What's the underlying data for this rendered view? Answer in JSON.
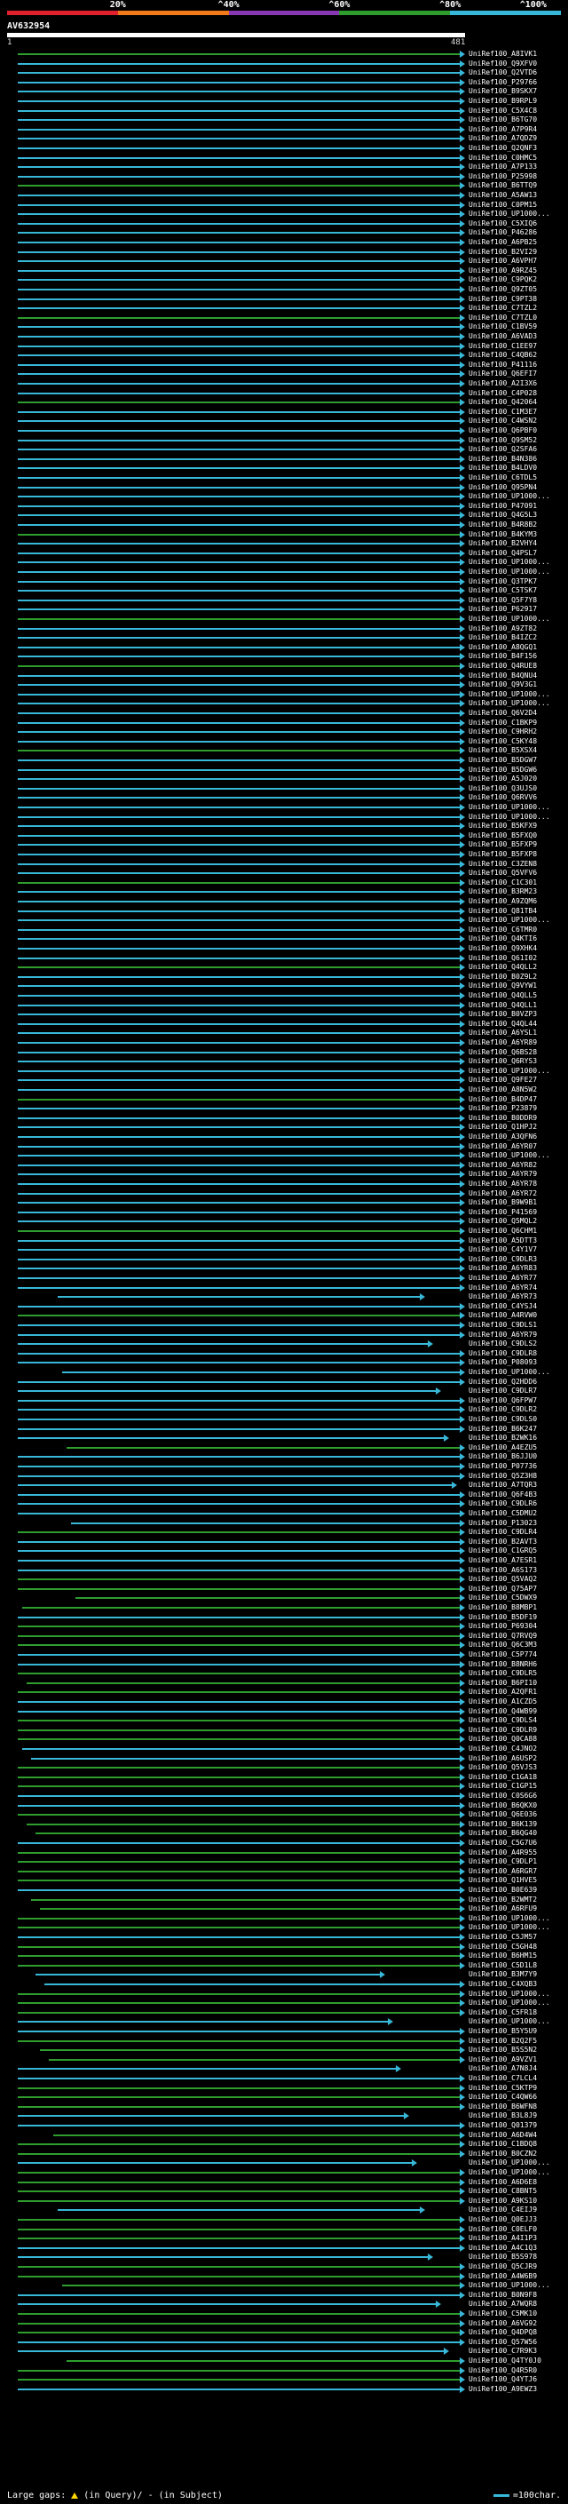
{
  "scale": {
    "labels": [
      "20%",
      "^40%",
      "^60%",
      "^80%",
      "^100%"
    ],
    "colors": [
      "#e0202c",
      "#f07a1a",
      "#8a37b4",
      "#2e9d2e",
      "#38b8d8"
    ]
  },
  "query": {
    "name": "AV632954",
    "start": "1",
    "end": "481"
  },
  "legend": {
    "large_gaps": "Large gaps:",
    "in_query": "(in Query)/",
    "in_subject": "(in Subject)",
    "scale_note": "=100char."
  },
  "hits": [
    "UniRef100_A8IVK1",
    "UniRef100_Q9XFV0",
    "UniRef100_Q2VTD6",
    "UniRef100_P29766",
    "UniRef100_B9SKX7",
    "UniRef100_B9RPL9",
    "UniRef100_C5X4C8",
    "UniRef100_B6TG70",
    "UniRef100_A7P9R4",
    "UniRef100_A7QDZ9",
    "UniRef100_Q2QNF3",
    "UniRef100_C0HMC5",
    "UniRef100_A7P133",
    "UniRef100_P25998",
    "UniRef100_B6TTQ9",
    "UniRef100_A5AW13",
    "UniRef100_C0PM15",
    "UniRef100_UP1000...",
    "UniRef100_C5XIQ6",
    "UniRef100_P46286",
    "UniRef100_A6PB25",
    "UniRef100_B2VI29",
    "UniRef100_A6VPH7",
    "UniRef100_A9RZ45",
    "UniRef100_C9PQK2",
    "UniRef100_Q9ZT05",
    "UniRef100_C9PT38",
    "UniRef100_C7TZL2",
    "UniRef100_C7TZL0",
    "UniRef100_C1BV59",
    "UniRef100_A6VAD3",
    "UniRef100_C1EE97",
    "UniRef100_C4QB62",
    "UniRef100_P41116",
    "UniRef100_Q6EFI7",
    "UniRef100_A2I3X6",
    "UniRef100_C4P028",
    "UniRef100_Q42064",
    "UniRef100_C1M3E7",
    "UniRef100_C4WSN2",
    "UniRef100_Q6PBF0",
    "UniRef100_Q9SM52",
    "UniRef100_Q2SFA6",
    "UniRef100_B4N386",
    "UniRef100_B4LDV0",
    "UniRef100_C6TDL5",
    "UniRef100_Q95PN4",
    "UniRef100_UP1000...",
    "UniRef100_P47091",
    "UniRef100_Q4G5L3",
    "UniRef100_B4R8B2",
    "UniRef100_B4KYM3",
    "UniRef100_B2VHY4",
    "UniRef100_Q4PSL7",
    "UniRef100_UP1000...",
    "UniRef100_UP1000...",
    "UniRef100_Q3TPK7",
    "UniRef100_C5TSK7",
    "UniRef100_Q5F7Y8",
    "UniRef100_P62917",
    "UniRef100_UP1000...",
    "UniRef100_A9ZT82",
    "UniRef100_B4IZC2",
    "UniRef100_A8QGQ1",
    "UniRef100_B4F156",
    "UniRef100_Q4RUE8",
    "UniRef100_B4QNU4",
    "UniRef100_Q9V3G1",
    "UniRef100_UP1000...",
    "UniRef100_UP1000...",
    "UniRef100_Q6V2D4",
    "UniRef100_C1BKP9",
    "UniRef100_C9HRH2",
    "UniRef100_C5KY48",
    "UniRef100_B5XSX4",
    "UniRef100_B5DGW7",
    "UniRef100_B5DGW6",
    "UniRef100_A5J020",
    "UniRef100_Q3UJS0",
    "UniRef100_Q6RVV6",
    "UniRef100_UP1000...",
    "UniRef100_UP1000...",
    "UniRef100_B5KFX9",
    "UniRef100_B5FXQ0",
    "UniRef100_B5FXP9",
    "UniRef100_B5FXP8",
    "UniRef100_C3ZEN8",
    "UniRef100_Q5VFV6",
    "UniRef100_C1C301",
    "UniRef100_B3RM23",
    "UniRef100_A9ZQM6",
    "UniRef100_Q81TB4",
    "UniRef100_UP1000...",
    "UniRef100_C6TMR0",
    "UniRef100_Q4KTI6",
    "UniRef100_Q9XHK4",
    "UniRef100_Q61I02",
    "UniRef100_Q4QLL2",
    "UniRef100_B0Z9L2",
    "UniRef100_Q9VYW1",
    "UniRef100_Q4QLL5",
    "UniRef100_Q4QLL1",
    "UniRef100_B0VZP3",
    "UniRef100_Q4QL44",
    "UniRef100_A6YSL1",
    "UniRef100_A6YR89",
    "UniRef100_Q6BS28",
    "UniRef100_Q6RYS3",
    "UniRef100_UP1000...",
    "UniRef100_Q9FE27",
    "UniRef100_A8N5W2",
    "UniRef100_B4DP47",
    "UniRef100_P23879",
    "UniRef100_B0DDR9",
    "UniRef100_Q1HPJ2",
    "UniRef100_A3QFN6",
    "UniRef100_A6YR07",
    "UniRef100_UP1000...",
    "UniRef100_A6YR82",
    "UniRef100_A6YR79",
    "UniRef100_A6YR78",
    "UniRef100_A6YR72",
    "UniRef100_B9W9B1",
    "UniRef100_P41569",
    "UniRef100_Q5MQL2",
    "UniRef100_Q6CHM1",
    "UniRef100_A5DTT3",
    "UniRef100_C4Y1V7",
    "UniRef100_C9DLR3",
    "UniRef100_A6YR83",
    "UniRef100_A6YR77",
    "UniRef100_A6YR74",
    "UniRef100_A6YR73",
    "UniRef100_C4YSJ4",
    "UniRef100_A4RVW0",
    "UniRef100_C9DLS1",
    "UniRef100_A6YR79",
    "UniRef100_C9DLS2",
    "UniRef100_C9DLR8",
    "UniRef100_P08093",
    "UniRef100_UP1000...",
    "UniRef100_Q2HDD6",
    "UniRef100_C9DLR7",
    "UniRef100_Q6FPW7",
    "UniRef100_C9DLR2",
    "UniRef100_C9DLS0",
    "UniRef100_B6K247",
    "UniRef100_B2WK16",
    "UniRef100_A4EZU5",
    "UniRef100_B6JJU0",
    "UniRef100_P07736",
    "UniRef100_Q5Z3H8",
    "UniRef100_A7TQR3",
    "UniRef100_Q6F4B3",
    "UniRef100_C9DLR6",
    "UniRef100_C5DMU2",
    "UniRef100_P13023",
    "UniRef100_C9DLR4",
    "UniRef100_B2AVT3",
    "UniRef100_C1GRQ5",
    "UniRef100_A7ESR1",
    "UniRef100_A6S173",
    "UniRef100_Q5VAQ2",
    "UniRef100_Q75AP7",
    "UniRef100_C5DWX9",
    "UniRef100_B8MBP1",
    "UniRef100_B5DF19",
    "UniRef100_P69304",
    "UniRef100_Q7RVQ9",
    "UniRef100_Q6C3M3",
    "UniRef100_C5P774",
    "UniRef100_B8NRH6",
    "UniRef100_C9DLR5",
    "UniRef100_B6PI10",
    "UniRef100_A2QFR1",
    "UniRef100_A1CZD5",
    "UniRef100_Q4WB99",
    "UniRef100_C9DLS4",
    "UniRef100_C9DLR9",
    "UniRef100_Q0CA88",
    "UniRef100_C4JNO2",
    "UniRef100_A6USP2",
    "UniRef100_Q5VJS3",
    "UniRef100_C1GA18",
    "UniRef100_C1GP15",
    "UniRef100_C0S6G6",
    "UniRef100_B6QKX0",
    "UniRef100_Q6E036",
    "UniRef100_B6K139",
    "UniRef100_B6QG40",
    "UniRef100_C5G7U6",
    "UniRef100_A4R955",
    "UniRef100_C9DLP1",
    "UniRef100_A6RGR7",
    "UniRef100_Q1HVE5",
    "UniRef100_B0E639",
    "UniRef100_B2WMT2",
    "UniRef100_A6RFU9",
    "UniRef100_UP1000...",
    "UniRef100_UP1000...",
    "UniRef100_C5JM57",
    "UniRef100_C5GH48",
    "UniRef100_B6HM15",
    "UniRef100_C5D1L8",
    "UniRef100_B3M7Y9",
    "UniRef100_C4XQB3",
    "UniRef100_UP1000...",
    "UniRef100_UP1000...",
    "UniRef100_C5FR18",
    "UniRef100_UP1000...",
    "UniRef100_B5Y5U9",
    "UniRef100_B2Q2F5",
    "UniRef100_B5S5N2",
    "UniRef100_A9VZV1",
    "UniRef100_A7N8J4",
    "UniRef100_C7LCL4",
    "UniRef100_C5KTP9",
    "UniRef100_C4QW66",
    "UniRef100_B6WFN8",
    "UniRef100_B3L8J9",
    "UniRef100_Q01379",
    "UniRef100_A6D4W4",
    "UniRef100_C1BDQ8",
    "UniRef100_B0CZN2",
    "UniRef100_UP1000...",
    "UniRef100_UP1000...",
    "UniRef100_A6D6E8",
    "UniRef100_C8BNT5",
    "UniRef100_A9KS10",
    "UniRef100_C4EIJ9",
    "UniRef100_Q0EJJ3",
    "UniRef100_C0ELF0",
    "UniRef100_A4I1P3",
    "UniRef100_A4C1Q3",
    "UniRef100_B5S978",
    "UniRef100_Q5CJR9",
    "UniRef100_A4W6B9",
    "UniRef100_UP1000...",
    "UniRef100_B0N9F8",
    "UniRef100_A7WQR8",
    "UniRef100_C5MK10",
    "UniRef100_A6VG92",
    "UniRef100_Q4DPQ8",
    "UniRef100_Q57W56",
    "UniRef100_C7R9K3",
    "UniRef100_Q4TY0J0",
    "UniRef100_Q4R5R0",
    "UniRef100_Q4YTJ6",
    "UniRef100_A9EWZ3"
  ]
}
